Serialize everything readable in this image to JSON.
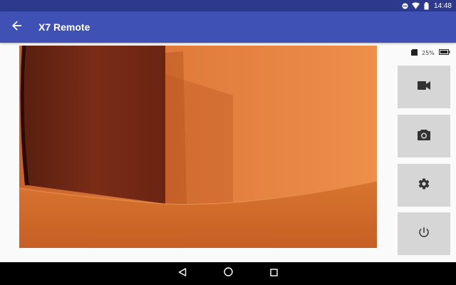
{
  "status_bar": {
    "time": "14:48",
    "icons": [
      "do-not-disturb-icon",
      "wifi-icon",
      "battery-icon"
    ]
  },
  "app_bar": {
    "title": "X7 Remote",
    "back_icon": "arrow-back-icon"
  },
  "camera_status": {
    "sd_icon": "sd-card-icon",
    "storage_used": "25%",
    "battery_icon": "battery-full-icon"
  },
  "side_buttons": [
    {
      "icon": "videocam-icon"
    },
    {
      "icon": "camera-icon"
    },
    {
      "icon": "settings-icon"
    },
    {
      "icon": "power-icon"
    }
  ],
  "nav_bar": {
    "icons": [
      "back-triangle-icon",
      "home-circle-icon",
      "recents-square-icon"
    ]
  },
  "colors": {
    "status_bar": "#2d3a8c",
    "app_bar": "#3f51b5",
    "button_bg": "#d6d6d6",
    "icon": "#333333"
  }
}
